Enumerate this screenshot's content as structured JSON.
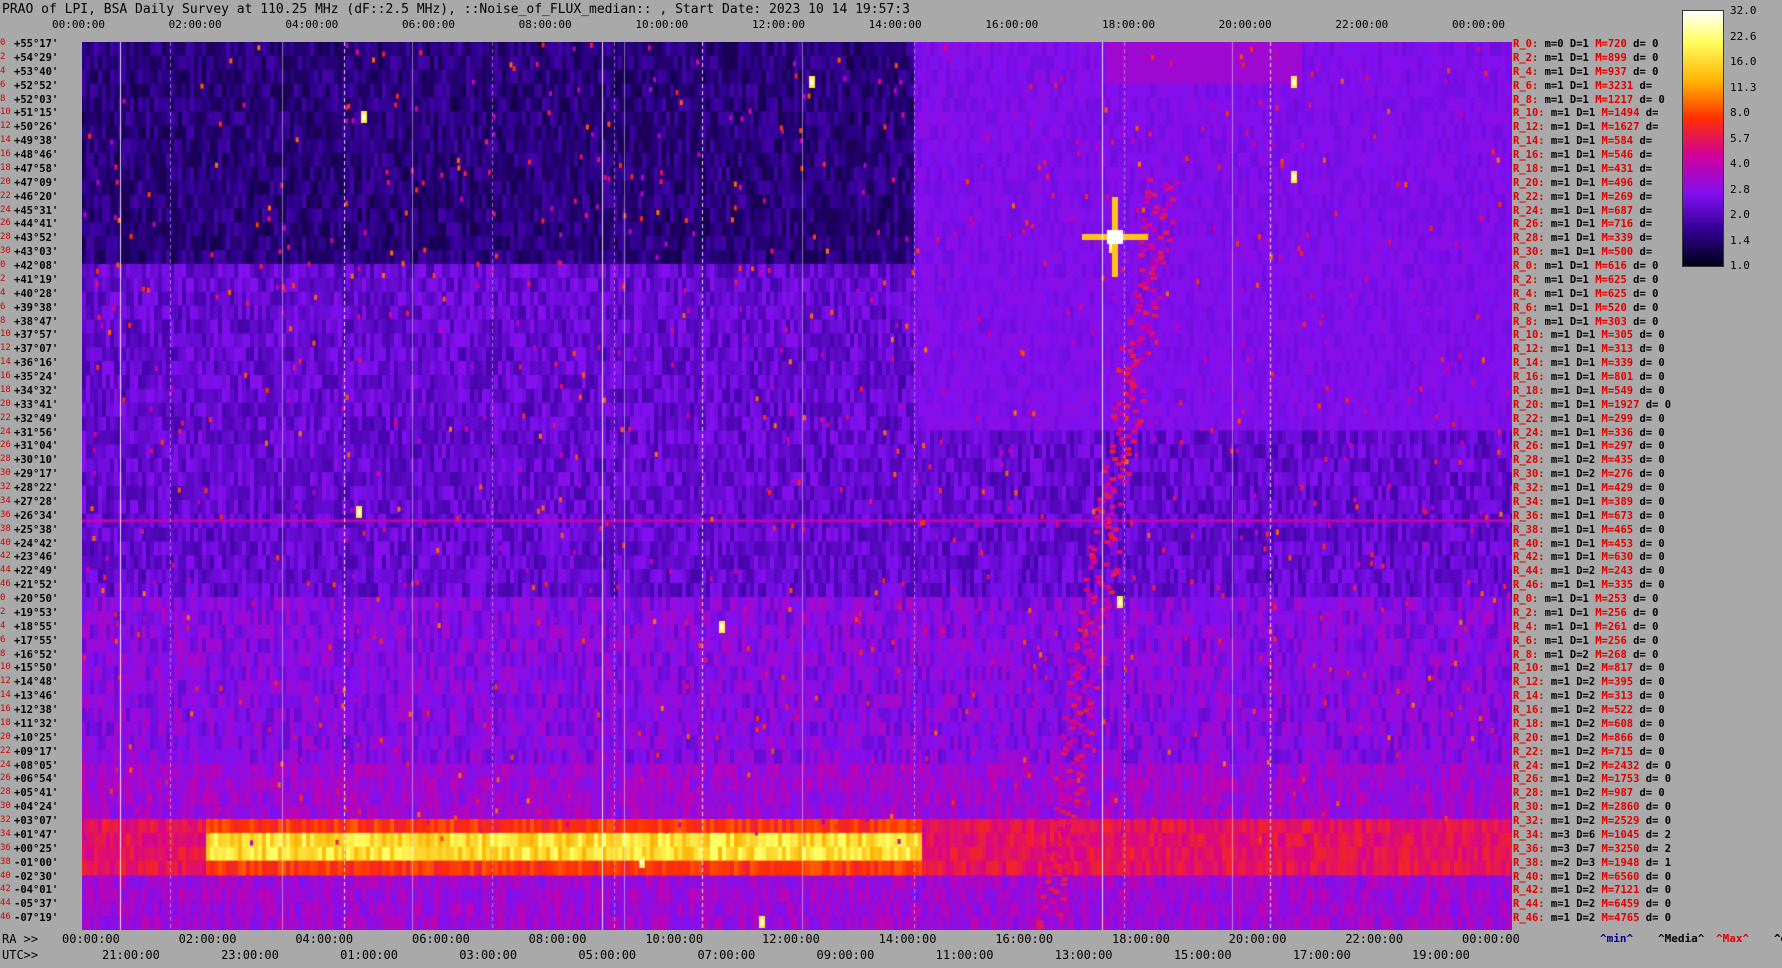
{
  "title": "PRAO of LPI, BSA Daily Survey at 110.25 MHz (dF::2.5 MHz), ::Noise_of_FLUX_median:: , Start Date: 2023 10 14 19:57:3",
  "chart_data": {
    "type": "heatmap",
    "top_ticks": [
      "00:00:00",
      "02:00:00",
      "04:00:00",
      "06:00:00",
      "08:00:00",
      "10:00:00",
      "12:00:00",
      "14:00:00",
      "16:00:00",
      "18:00:00",
      "20:00:00",
      "22:00:00",
      "00:00:00"
    ],
    "ra_prefix": "RA >>",
    "ra_ticks": [
      "00:00:00",
      "02:00:00",
      "04:00:00",
      "06:00:00",
      "08:00:00",
      "10:00:00",
      "12:00:00",
      "14:00:00",
      "16:00:00",
      "18:00:00",
      "20:00:00",
      "22:00:00",
      "00:00:00"
    ],
    "utc_prefix": "UTC>>",
    "utc_ticks": [
      "21:00:00",
      "23:00:00",
      "01:00:00",
      "03:00:00",
      "05:00:00",
      "07:00:00",
      "09:00:00",
      "11:00:00",
      "13:00:00",
      "15:00:00",
      "17:00:00",
      "19:00:00"
    ],
    "declinations": [
      "+55°17'",
      "+54°29'",
      "+53°40'",
      "+52°52'",
      "+52°03'",
      "+51°15'",
      "+50°26'",
      "+49°38'",
      "+48°46'",
      "+47°58'",
      "+47°09'",
      "+46°20'",
      "+45°31'",
      "+44°41'",
      "+43°52'",
      "+43°03'",
      "+42°08'",
      "+41°19'",
      "+40°28'",
      "+39°38'",
      "+38°47'",
      "+37°57'",
      "+37°07'",
      "+36°16'",
      "+35°24'",
      "+34°32'",
      "+33°41'",
      "+32°49'",
      "+31°56'",
      "+31°04'",
      "+30°10'",
      "+29°17'",
      "+28°22'",
      "+27°28'",
      "+26°34'",
      "+25°38'",
      "+24°42'",
      "+23°46'",
      "+22°49'",
      "+21°52'",
      "+20°50'",
      "+19°53'",
      "+18°55'",
      "+17°55'",
      "+16°52'",
      "+15°50'",
      "+14°48'",
      "+13°46'",
      "+12°38'",
      "+11°32'",
      "+10°25'",
      "+09°17'",
      "+08°05'",
      "+06°54'",
      "+05°41'",
      "+04°24'",
      "+03°07'",
      "+01°47'",
      "+00°25'",
      "-01°00'",
      "-02°30'",
      "-04°01'",
      "-05°37'",
      "-07°19'"
    ],
    "beam_index": [
      "0",
      "2",
      "4",
      "6",
      "8",
      "10",
      "12",
      "14",
      "16",
      "18",
      "20",
      "22",
      "24",
      "26",
      "28",
      "30",
      "0",
      "2",
      "4",
      "6",
      "8",
      "10",
      "12",
      "14",
      "16",
      "18",
      "20",
      "22",
      "24",
      "26",
      "28",
      "30",
      "32",
      "34",
      "36",
      "38",
      "40",
      "42",
      "44",
      "46",
      "0",
      "2",
      "4",
      "6",
      "8",
      "10",
      "12",
      "14",
      "16",
      "18",
      "20",
      "22",
      "24",
      "26",
      "28",
      "30",
      "32",
      "34",
      "36",
      "38",
      "40",
      "42",
      "44",
      "46"
    ],
    "row_stats": [
      {
        "r": "R_0:",
        "m": "m=0",
        "d": "D=1",
        "M": "M=720",
        "dv": "d= 0"
      },
      {
        "r": "R_2:",
        "m": "m=1",
        "d": "D=1",
        "M": "M=899",
        "dv": "d= 0"
      },
      {
        "r": "R_4:",
        "m": "m=1",
        "d": "D=1",
        "M": "M=937",
        "dv": "d= 0"
      },
      {
        "r": "R_6:",
        "m": "m=1",
        "d": "D=1",
        "M": "M=3231",
        "dv": "d="
      },
      {
        "r": "R_8:",
        "m": "m=1",
        "d": "D=1",
        "M": "M=1217",
        "dv": "d= 0"
      },
      {
        "r": "R_10:",
        "m": "m=1",
        "d": "D=1",
        "M": "M=1494",
        "dv": "d="
      },
      {
        "r": "R_12:",
        "m": "m=1",
        "d": "D=1",
        "M": "M=1627",
        "dv": "d="
      },
      {
        "r": "R_14:",
        "m": "m=1",
        "d": "D=1",
        "M": "M=584",
        "dv": "d="
      },
      {
        "r": "R_16:",
        "m": "m=1",
        "d": "D=1",
        "M": "M=546",
        "dv": "d="
      },
      {
        "r": "R_18:",
        "m": "m=1",
        "d": "D=1",
        "M": "M=431",
        "dv": "d="
      },
      {
        "r": "R_20:",
        "m": "m=1",
        "d": "D=1",
        "M": "M=496",
        "dv": "d="
      },
      {
        "r": "R_22:",
        "m": "m=1",
        "d": "D=1",
        "M": "M=269",
        "dv": "d="
      },
      {
        "r": "R_24:",
        "m": "m=1",
        "d": "D=1",
        "M": "M=687",
        "dv": "d="
      },
      {
        "r": "R_26:",
        "m": "m=1",
        "d": "D=1",
        "M": "M=716",
        "dv": "d="
      },
      {
        "r": "R_28:",
        "m": "m=1",
        "d": "D=1",
        "M": "M=339",
        "dv": "d="
      },
      {
        "r": "R_30:",
        "m": "m=1",
        "d": "D=1",
        "M": "M=500",
        "dv": "d="
      },
      {
        "r": "R_0:",
        "m": "m=1",
        "d": "D=1",
        "M": "M=616",
        "dv": "d= 0"
      },
      {
        "r": "R_2:",
        "m": "m=1",
        "d": "D=1",
        "M": "M=625",
        "dv": "d= 0"
      },
      {
        "r": "R_4:",
        "m": "m=1",
        "d": "D=1",
        "M": "M=625",
        "dv": "d= 0"
      },
      {
        "r": "R_6:",
        "m": "m=1",
        "d": "D=1",
        "M": "M=520",
        "dv": "d= 0"
      },
      {
        "r": "R_8:",
        "m": "m=1",
        "d": "D=1",
        "M": "M=303",
        "dv": "d= 0"
      },
      {
        "r": "R_10:",
        "m": "m=1",
        "d": "D=1",
        "M": "M=305",
        "dv": "d= 0"
      },
      {
        "r": "R_12:",
        "m": "m=1",
        "d": "D=1",
        "M": "M=313",
        "dv": "d= 0"
      },
      {
        "r": "R_14:",
        "m": "m=1",
        "d": "D=1",
        "M": "M=339",
        "dv": "d= 0"
      },
      {
        "r": "R_16:",
        "m": "m=1",
        "d": "D=1",
        "M": "M=801",
        "dv": "d= 0"
      },
      {
        "r": "R_18:",
        "m": "m=1",
        "d": "D=1",
        "M": "M=549",
        "dv": "d= 0"
      },
      {
        "r": "R_20:",
        "m": "m=1",
        "d": "D=1",
        "M": "M=1927",
        "dv": "d= 0"
      },
      {
        "r": "R_22:",
        "m": "m=1",
        "d": "D=1",
        "M": "M=299",
        "dv": "d= 0"
      },
      {
        "r": "R_24:",
        "m": "m=1",
        "d": "D=1",
        "M": "M=336",
        "dv": "d= 0"
      },
      {
        "r": "R_26:",
        "m": "m=1",
        "d": "D=1",
        "M": "M=297",
        "dv": "d= 0"
      },
      {
        "r": "R_28:",
        "m": "m=1",
        "d": "D=2",
        "M": "M=435",
        "dv": "d= 0"
      },
      {
        "r": "R_30:",
        "m": "m=1",
        "d": "D=2",
        "M": "M=276",
        "dv": "d= 0"
      },
      {
        "r": "R_32:",
        "m": "m=1",
        "d": "D=1",
        "M": "M=429",
        "dv": "d= 0"
      },
      {
        "r": "R_34:",
        "m": "m=1",
        "d": "D=1",
        "M": "M=389",
        "dv": "d= 0"
      },
      {
        "r": "R_36:",
        "m": "m=1",
        "d": "D=1",
        "M": "M=673",
        "dv": "d= 0"
      },
      {
        "r": "R_38:",
        "m": "m=1",
        "d": "D=1",
        "M": "M=465",
        "dv": "d= 0"
      },
      {
        "r": "R_40:",
        "m": "m=1",
        "d": "D=1",
        "M": "M=453",
        "dv": "d= 0"
      },
      {
        "r": "R_42:",
        "m": "m=1",
        "d": "D=1",
        "M": "M=630",
        "dv": "d= 0"
      },
      {
        "r": "R_44:",
        "m": "m=1",
        "d": "D=2",
        "M": "M=243",
        "dv": "d= 0"
      },
      {
        "r": "R_46:",
        "m": "m=1",
        "d": "D=1",
        "M": "M=335",
        "dv": "d= 0"
      },
      {
        "r": "R_0:",
        "m": "m=1",
        "d": "D=1",
        "M": "M=253",
        "dv": "d= 0"
      },
      {
        "r": "R_2:",
        "m": "m=1",
        "d": "D=1",
        "M": "M=256",
        "dv": "d= 0"
      },
      {
        "r": "R_4:",
        "m": "m=1",
        "d": "D=1",
        "M": "M=261",
        "dv": "d= 0"
      },
      {
        "r": "R_6:",
        "m": "m=1",
        "d": "D=1",
        "M": "M=256",
        "dv": "d= 0"
      },
      {
        "r": "R_8:",
        "m": "m=1",
        "d": "D=2",
        "M": "M=268",
        "dv": "d= 0"
      },
      {
        "r": "R_10:",
        "m": "m=1",
        "d": "D=2",
        "M": "M=817",
        "dv": "d= 0"
      },
      {
        "r": "R_12:",
        "m": "m=1",
        "d": "D=2",
        "M": "M=395",
        "dv": "d= 0"
      },
      {
        "r": "R_14:",
        "m": "m=1",
        "d": "D=2",
        "M": "M=313",
        "dv": "d= 0"
      },
      {
        "r": "R_16:",
        "m": "m=1",
        "d": "D=2",
        "M": "M=522",
        "dv": "d= 0"
      },
      {
        "r": "R_18:",
        "m": "m=1",
        "d": "D=2",
        "M": "M=608",
        "dv": "d= 0"
      },
      {
        "r": "R_20:",
        "m": "m=1",
        "d": "D=2",
        "M": "M=866",
        "dv": "d= 0"
      },
      {
        "r": "R_22:",
        "m": "m=1",
        "d": "D=2",
        "M": "M=715",
        "dv": "d= 0"
      },
      {
        "r": "R_24:",
        "m": "m=1",
        "d": "D=2",
        "M": "M=2432",
        "dv": "d= 0"
      },
      {
        "r": "R_26:",
        "m": "m=1",
        "d": "D=2",
        "M": "M=1753",
        "dv": "d= 0"
      },
      {
        "r": "R_28:",
        "m": "m=1",
        "d": "D=2",
        "M": "M=987",
        "dv": "d= 0"
      },
      {
        "r": "R_30:",
        "m": "m=1",
        "d": "D=2",
        "M": "M=2860",
        "dv": "d= 0"
      },
      {
        "r": "R_32:",
        "m": "m=1",
        "d": "D=2",
        "M": "M=2529",
        "dv": "d= 0"
      },
      {
        "r": "R_34:",
        "m": "m=3",
        "d": "D=6",
        "M": "M=1045",
        "dv": "d= 2"
      },
      {
        "r": "R_36:",
        "m": "m=3",
        "d": "D=7",
        "M": "M=3250",
        "dv": "d= 2"
      },
      {
        "r": "R_38:",
        "m": "m=2",
        "d": "D=3",
        "M": "M=1948",
        "dv": "d= 1"
      },
      {
        "r": "R_40:",
        "m": "m=1",
        "d": "D=2",
        "M": "M=6560",
        "dv": "d= 0"
      },
      {
        "r": "R_42:",
        "m": "m=1",
        "d": "D=2",
        "M": "M=7121",
        "dv": "d= 0"
      },
      {
        "r": "R_44:",
        "m": "m=1",
        "d": "D=2",
        "M": "M=6459",
        "dv": "d= 0"
      },
      {
        "r": "R_46:",
        "m": "m=1",
        "d": "D=2",
        "M": "M=4765",
        "dv": "d= 0"
      }
    ],
    "colorbar_ticks": [
      "32.0",
      "22.6",
      "16.0",
      "11.3",
      "8.0",
      "5.7",
      "4.0",
      "2.8",
      "2.0",
      "1.4",
      "1.0"
    ],
    "footer_keys": [
      "^min^",
      "^Media^",
      "^Max^",
      "^devia^"
    ],
    "colorscale": [
      "#000018",
      "#300090",
      "#8010f0",
      "#d000a0",
      "#ff3000",
      "#ffb000",
      "#ffff60",
      "#ffffff"
    ]
  }
}
